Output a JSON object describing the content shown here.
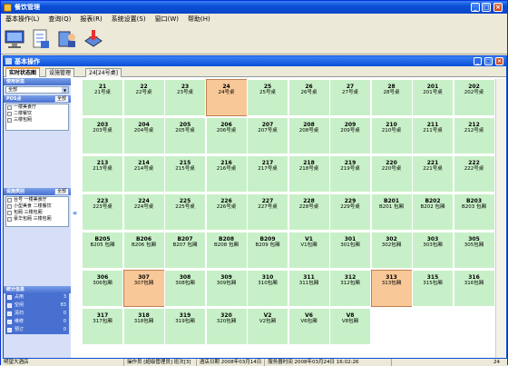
{
  "app": {
    "title": "餐饮管理"
  },
  "menu": [
    "基本操作(L)",
    "查询(Q)",
    "报表(R)",
    "系统设置(S)",
    "窗口(W)",
    "帮助(H)"
  ],
  "inner": {
    "title": "基本操作"
  },
  "tabs": [
    "实时状态图",
    "设施管理",
    "24[24号桌]"
  ],
  "sidebar": {
    "usage_title": "使用状态",
    "usage_value": "全部",
    "pos_title": "POS点",
    "pos_all": "全部",
    "pos_items": [
      "一楼美食厅",
      "二楼餐饮",
      "三楼包厢"
    ],
    "facility_title": "设施类别",
    "facility_all": "全部",
    "facility_items": [
      "台号 一楼美食厅",
      "小型美食 二楼餐饮",
      "包厢 三楼包厢",
      "豪华包厢 三楼包厢"
    ],
    "stats_title": "统计信息",
    "stats": [
      {
        "label": "占用",
        "value": "3"
      },
      {
        "label": "空闲",
        "value": "83"
      },
      {
        "label": "清扫",
        "value": "0"
      },
      {
        "label": "维修",
        "value": "0"
      },
      {
        "label": "预订",
        "value": "0"
      }
    ]
  },
  "tables": [
    {
      "num": "21",
      "name": "21号桌"
    },
    {
      "num": "22",
      "name": "22号桌"
    },
    {
      "num": "23",
      "name": "23号桌"
    },
    {
      "num": "24",
      "name": "24号桌",
      "occupied": true
    },
    {
      "num": "25",
      "name": "25号桌"
    },
    {
      "num": "26",
      "name": "26号桌"
    },
    {
      "num": "27",
      "name": "27号桌"
    },
    {
      "num": "28",
      "name": "28号桌"
    },
    {
      "num": "201",
      "name": "201号桌"
    },
    {
      "num": "202",
      "name": "202号桌"
    },
    {
      "num": "203",
      "name": "203号桌"
    },
    {
      "num": "204",
      "name": "204号桌"
    },
    {
      "num": "205",
      "name": "205号桌"
    },
    {
      "num": "206",
      "name": "206号桌"
    },
    {
      "num": "207",
      "name": "207号桌"
    },
    {
      "num": "208",
      "name": "208号桌"
    },
    {
      "num": "209",
      "name": "209号桌"
    },
    {
      "num": "210",
      "name": "210号桌"
    },
    {
      "num": "211",
      "name": "211号桌"
    },
    {
      "num": "212",
      "name": "212号桌"
    },
    {
      "num": "213",
      "name": "213号桌"
    },
    {
      "num": "214",
      "name": "214号桌"
    },
    {
      "num": "215",
      "name": "215号桌"
    },
    {
      "num": "216",
      "name": "216号桌"
    },
    {
      "num": "217",
      "name": "217号桌"
    },
    {
      "num": "218",
      "name": "218号桌"
    },
    {
      "num": "219",
      "name": "219号桌"
    },
    {
      "num": "220",
      "name": "220号桌"
    },
    {
      "num": "221",
      "name": "221号桌"
    },
    {
      "num": "222",
      "name": "222号桌"
    },
    {
      "num": "223",
      "name": "223号桌"
    },
    {
      "num": "224",
      "name": "224号桌"
    },
    {
      "num": "225",
      "name": "225号桌"
    },
    {
      "num": "226",
      "name": "226号桌"
    },
    {
      "num": "227",
      "name": "227号桌"
    },
    {
      "num": "228",
      "name": "228号桌"
    },
    {
      "num": "229",
      "name": "229号桌"
    },
    {
      "num": "B201",
      "name": "B201 包厢"
    },
    {
      "num": "B202",
      "name": "B202 包厢"
    },
    {
      "num": "B203",
      "name": "B203 包厢"
    },
    {
      "num": "B205",
      "name": "B205 包厢"
    },
    {
      "num": "B206",
      "name": "B206 包厢"
    },
    {
      "num": "B207",
      "name": "B207 包厢"
    },
    {
      "num": "B208",
      "name": "B208 包厢"
    },
    {
      "num": "B209",
      "name": "B209 包厢"
    },
    {
      "num": "V1",
      "name": "V1包厢"
    },
    {
      "num": "301",
      "name": "301包厢"
    },
    {
      "num": "302",
      "name": "302包厢"
    },
    {
      "num": "303",
      "name": "303包厢"
    },
    {
      "num": "305",
      "name": "305包厢"
    },
    {
      "num": "306",
      "name": "306包厢"
    },
    {
      "num": "307",
      "name": "307包厢",
      "occupied": true
    },
    {
      "num": "308",
      "name": "308包厢"
    },
    {
      "num": "309",
      "name": "309包厢"
    },
    {
      "num": "310",
      "name": "310包厢"
    },
    {
      "num": "311",
      "name": "311包厢"
    },
    {
      "num": "312",
      "name": "312包厢"
    },
    {
      "num": "313",
      "name": "313包厢",
      "occupied": true
    },
    {
      "num": "315",
      "name": "315包厢"
    },
    {
      "num": "316",
      "name": "316包厢"
    },
    {
      "num": "317",
      "name": "317包厢"
    },
    {
      "num": "318",
      "name": "318包厢"
    },
    {
      "num": "319",
      "name": "319包厢"
    },
    {
      "num": "320",
      "name": "320包厢"
    },
    {
      "num": "V2",
      "name": "V2包厢"
    },
    {
      "num": "V6",
      "name": "V6包厢"
    },
    {
      "num": "V8",
      "name": "V8包厢"
    }
  ],
  "status": {
    "hotel": "明望大酒店",
    "operator": "操作员 [超级管理员]  班次[3]",
    "date": "酒店日期  2008年03月14日",
    "server_time": "服务器时间  2008年03月24日  16:02:26",
    "count": "24"
  },
  "colors": {
    "free": "#c8f0c8",
    "occupied": "#f8c898",
    "titlebar": "#0a4fd8"
  }
}
